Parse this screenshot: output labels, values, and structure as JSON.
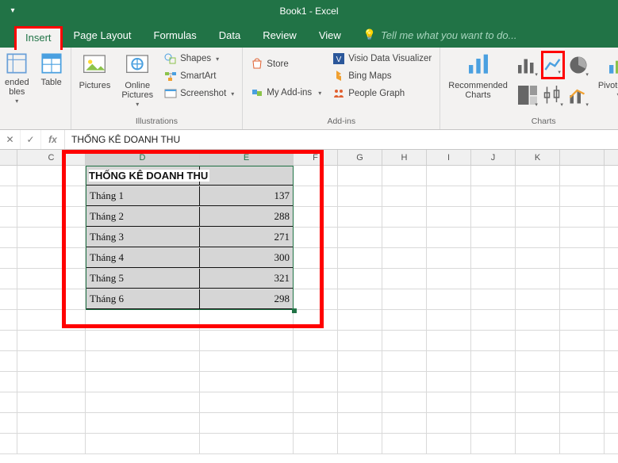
{
  "titlebar": {
    "title": "Book1 - Excel"
  },
  "tabs": {
    "insert": "Insert",
    "page_layout": "Page Layout",
    "formulas": "Formulas",
    "data": "Data",
    "review": "Review",
    "view": "View",
    "tellme": "Tell me what you want to do..."
  },
  "ribbon": {
    "tables": {
      "recommended": "ended\nbles",
      "table": "Table"
    },
    "illustrations": {
      "label": "Illustrations",
      "pictures": "Pictures",
      "online_pictures": "Online\nPictures",
      "shapes": "Shapes",
      "smartart": "SmartArt",
      "screenshot": "Screenshot"
    },
    "addins": {
      "label": "Add-ins",
      "store": "Store",
      "my_addins": "My Add-ins",
      "visio": "Visio Data Visualizer",
      "bing": "Bing Maps",
      "people": "People Graph"
    },
    "charts": {
      "label": "Charts",
      "recommended": "Recommended\nCharts",
      "pivotchart": "PivotChart"
    }
  },
  "formula_bar": {
    "value": "THỐNG KÊ DOANH THU"
  },
  "columns": [
    "",
    "C",
    "D",
    "E",
    "F",
    "G",
    "H",
    "I",
    "J",
    "K"
  ],
  "table": {
    "title": "THỐNG KÊ DOANH THU",
    "rows": [
      {
        "label": "Tháng 1",
        "value": "137"
      },
      {
        "label": "Tháng 2",
        "value": "288"
      },
      {
        "label": "Tháng 3",
        "value": "271"
      },
      {
        "label": "Tháng 4",
        "value": "300"
      },
      {
        "label": "Tháng 5",
        "value": "321"
      },
      {
        "label": "Tháng 6",
        "value": "298"
      }
    ]
  },
  "chart_data": {
    "type": "table",
    "title": "THỐNG KÊ DOANH THU",
    "categories": [
      "Tháng 1",
      "Tháng 2",
      "Tháng 3",
      "Tháng 4",
      "Tháng 5",
      "Tháng 6"
    ],
    "values": [
      137,
      288,
      271,
      300,
      321,
      298
    ]
  }
}
